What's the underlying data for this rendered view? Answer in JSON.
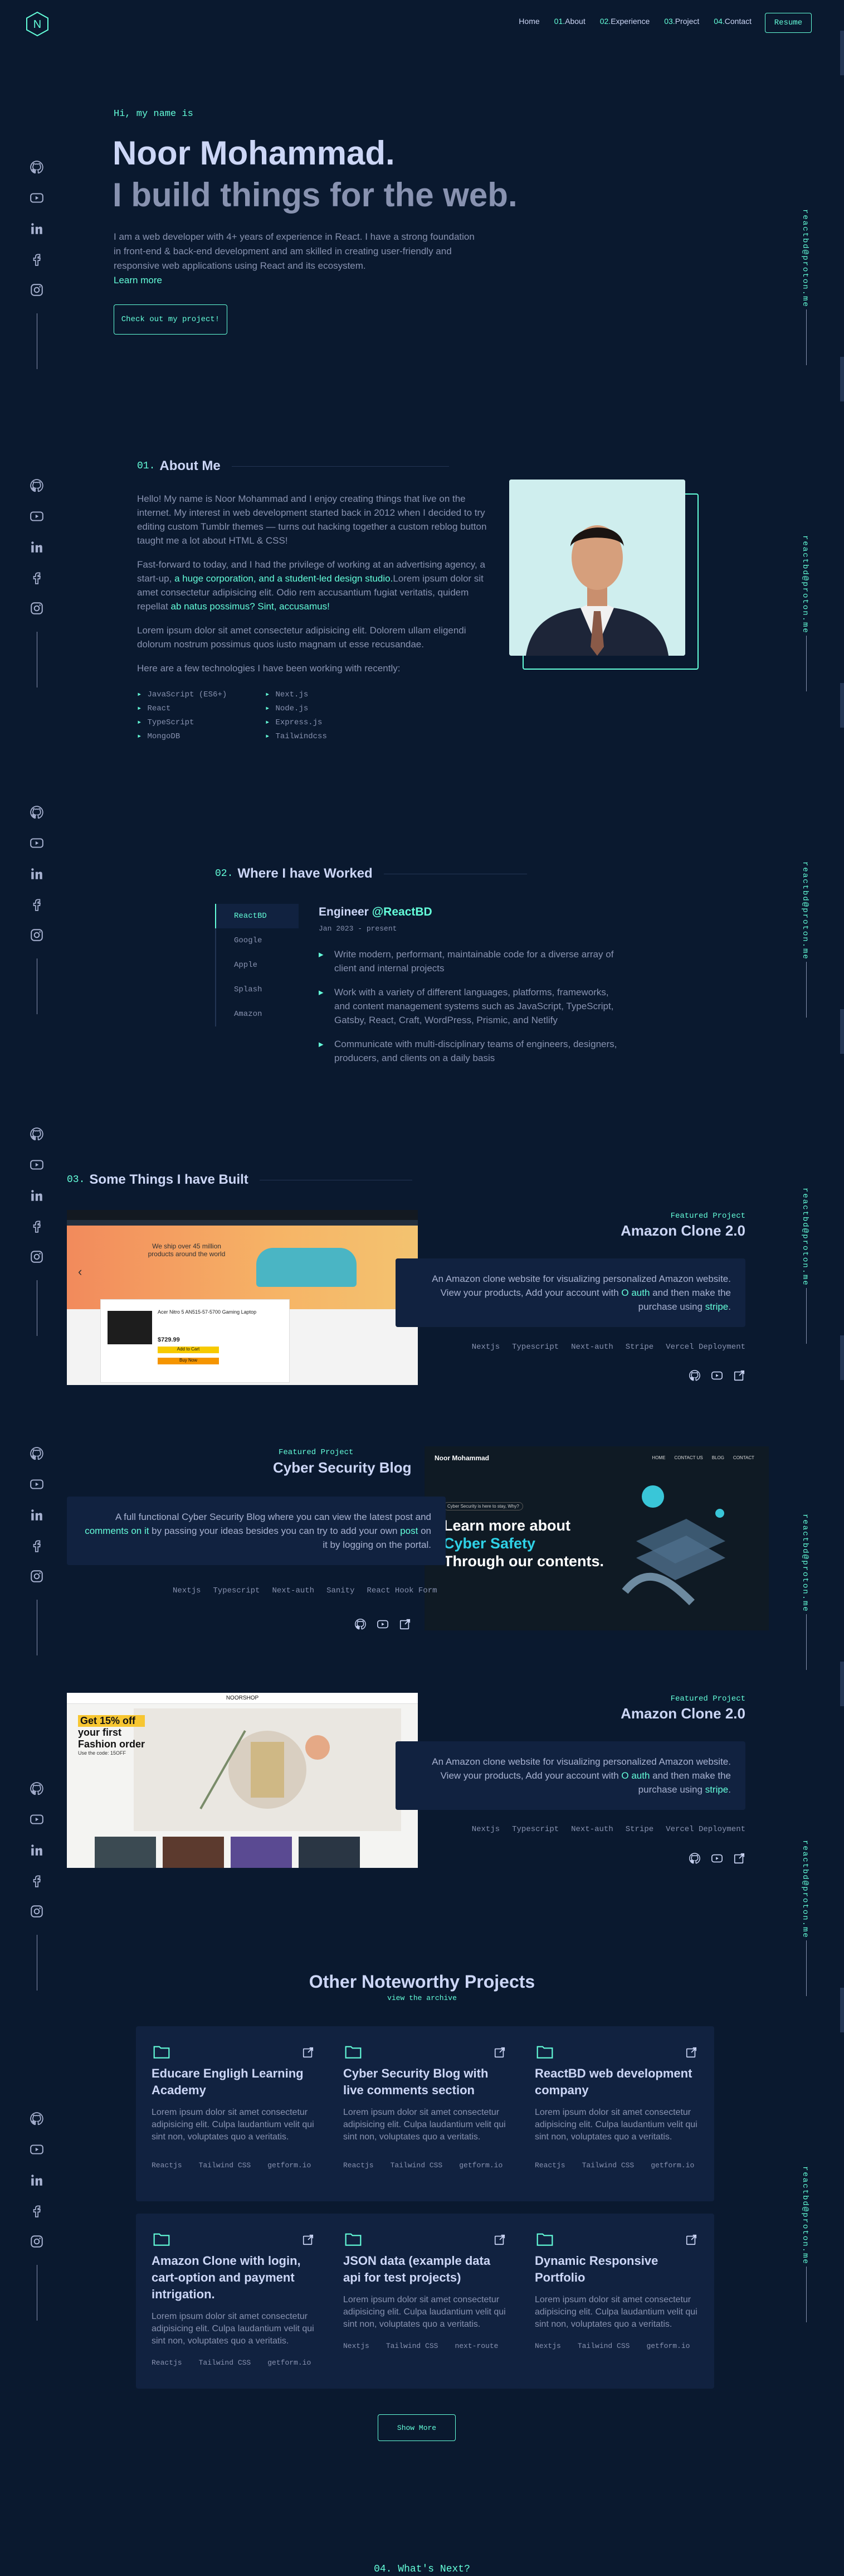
{
  "nav": {
    "links": [
      {
        "label": "Home"
      },
      {
        "num": "01.",
        "label": "About"
      },
      {
        "num": "02.",
        "label": "Experience"
      },
      {
        "num": "03.",
        "label": "Project"
      },
      {
        "num": "04.",
        "label": "Contact"
      }
    ],
    "resume_label": "Resume",
    "logo_letter": "N"
  },
  "email": "reactbd@proton.me",
  "social_icons": [
    "github-icon",
    "youtube-icon",
    "linkedin-icon",
    "facebook-icon",
    "instagram-icon"
  ],
  "hero": {
    "greeting": "Hi, my name is",
    "name": "Noor Mohammad.",
    "tagline": "I build things for the web.",
    "desc_1": "I am a web developer with 4+ years of experience in React. I have a strong foundation in front-end & back-end development and am skilled in creating user-friendly and responsive web applications using React and its ecosystem.",
    "learn_more": "Learn more",
    "cta": "Check out my project!"
  },
  "about": {
    "num": "01.",
    "title": "About Me",
    "p1": "Hello! My name is Noor Mohammad and I enjoy creating things that live on the internet. My interest in web development started back in 2012 when I decided to try editing custom Tumblr themes — turns out hacking together a custom reblog button taught me a lot about HTML & CSS!",
    "p2_a": "Fast-forward to today, and I had the privilege of working at an advertising agency, a start-up,",
    "p2_hl": " a huge corporation, and a student-led design studio.",
    "p2_b": "Lorem ipsum dolor sit amet consectetur adipisicing elit. Odio rem accusantium fugiat veritatis, quidem repellat",
    "p2_hl2": " ab natus possimus? Sint, accusamus!",
    "p3": "Lorem ipsum dolor sit amet consectetur adipisicing elit. Dolorem ullam eligendi dolorum nostrum possimus quos iusto magnam ut esse recusandae.",
    "p4": "Here are a few technologies I have been working with recently:",
    "tech": [
      "JavaScript (ES6+)",
      "Next.js",
      "React",
      "Node.js",
      "TypeScript",
      "Express.js",
      "MongoDB",
      "Tailwindcss"
    ]
  },
  "experience": {
    "num": "02.",
    "title": "Where I have Worked",
    "tabs": [
      "ReactBD",
      "Google",
      "Apple",
      "Splash",
      "Amazon"
    ],
    "role": "Engineer ",
    "company": "@ReactBD",
    "dates": "Jan 2023 - present",
    "duties": [
      "Write modern, performant, maintainable code for a diverse array of client and internal projects",
      "Work with a variety of different languages, platforms, frameworks, and content management systems such as JavaScript, TypeScript, Gatsby, React, Craft, WordPress, Prismic, and Netlify",
      "Communicate with multi-disciplinary teams of engineers, designers, producers, and clients on a daily basis"
    ]
  },
  "projects": {
    "num": "03.",
    "title": "Some Things I have Built",
    "featured_label": "Featured Project",
    "items": [
      {
        "title": "Amazon Clone 2.0",
        "desc_a": "An Amazon clone website for visualizing personalized Amazon website. View your products, Add your account with ",
        "desc_hl": "O auth",
        "desc_b": " and then make the purchase using ",
        "desc_hl2": "stripe",
        "desc_c": ".",
        "tech": [
          "Nextjs",
          "Typescript",
          "Next-auth",
          "Stripe",
          "Vercel Deployment"
        ]
      },
      {
        "title": "Cyber Security Blog",
        "desc_a": "A full functional Cyber Security Blog where you can view the latest post and ",
        "desc_hl": "comments on it",
        "desc_b": " by passing your ideas besides you can try to add your own ",
        "desc_hl2": "post",
        "desc_c": " on it by logging on the portal.",
        "tech": [
          "Nextjs",
          "Typescript",
          "Next-auth",
          "Sanity",
          "React Hook Form"
        ]
      },
      {
        "title": "Amazon Clone 2.0",
        "desc_a": "An Amazon clone website for visualizing personalized Amazon website. View your products, Add your account with ",
        "desc_hl": "O auth",
        "desc_b": " and then make the purchase using ",
        "desc_hl2": "stripe",
        "desc_c": ".",
        "tech": [
          "Nextjs",
          "Typescript",
          "Next-auth",
          "Stripe",
          "Vercel Deployment"
        ]
      }
    ],
    "shot1": {
      "banner": "We ship over 45 million products around the world",
      "card_title": "Acer Nitro 5 AN515-57-5700 Gaming Laptop",
      "price": "$729.99",
      "btn1": "Add to Cart",
      "btn2": "Buy Now"
    },
    "shot2": {
      "brand": "Noor Mohammad",
      "menu": [
        "HOME",
        "CONTACT US",
        "BLOG",
        "CONTACT"
      ],
      "badge": "Cyber Security is here to stay, Why?",
      "h1": "Learn more about",
      "h2": "Cyber Safety",
      "h3": "Through our contents."
    },
    "shot3": {
      "brand": "NOORSHOP",
      "promo": "Get 15% off",
      "l2": "your first",
      "l3": "Fashion order",
      "l4": "Use the code: 15OFF"
    }
  },
  "noteworthy": {
    "title": "Other Noteworthy Projects",
    "archive": "view the archive",
    "desc": "Lorem ipsum dolor sit amet consectetur adipisicing elit. Culpa laudantium velit qui sint non, voluptates quo a veritatis.",
    "items": [
      {
        "title": "Educare Engligh Learning Academy",
        "tags": [
          "Reactjs",
          "Tailwind CSS",
          "getform.io"
        ]
      },
      {
        "title": "Cyber Security Blog with live comments section",
        "tags": [
          "Reactjs",
          "Tailwind CSS",
          "getform.io"
        ]
      },
      {
        "title": "ReactBD web development company",
        "tags": [
          "Reactjs",
          "Tailwind CSS",
          "getform.io"
        ]
      },
      {
        "title": "Amazon Clone with login, cart-option and payment intrigation.",
        "tags": [
          "Reactjs",
          "Tailwind CSS",
          "getform.io"
        ]
      },
      {
        "title": "JSON data (example data api for test projects)",
        "tags": [
          "Nextjs",
          "Tailwind CSS",
          "next-route"
        ]
      },
      {
        "title": "Dynamic Responsive Portfolio",
        "tags": [
          "Nextjs",
          "Tailwind CSS",
          "getform.io"
        ]
      }
    ],
    "show_more": "Show More"
  },
  "contact": {
    "heading": "04. What's Next?"
  },
  "colors": {
    "bg": "#0a192f",
    "card": "#112240",
    "accent": "#64ffda",
    "text": "#8892b0",
    "heading": "#ccd6f6"
  }
}
